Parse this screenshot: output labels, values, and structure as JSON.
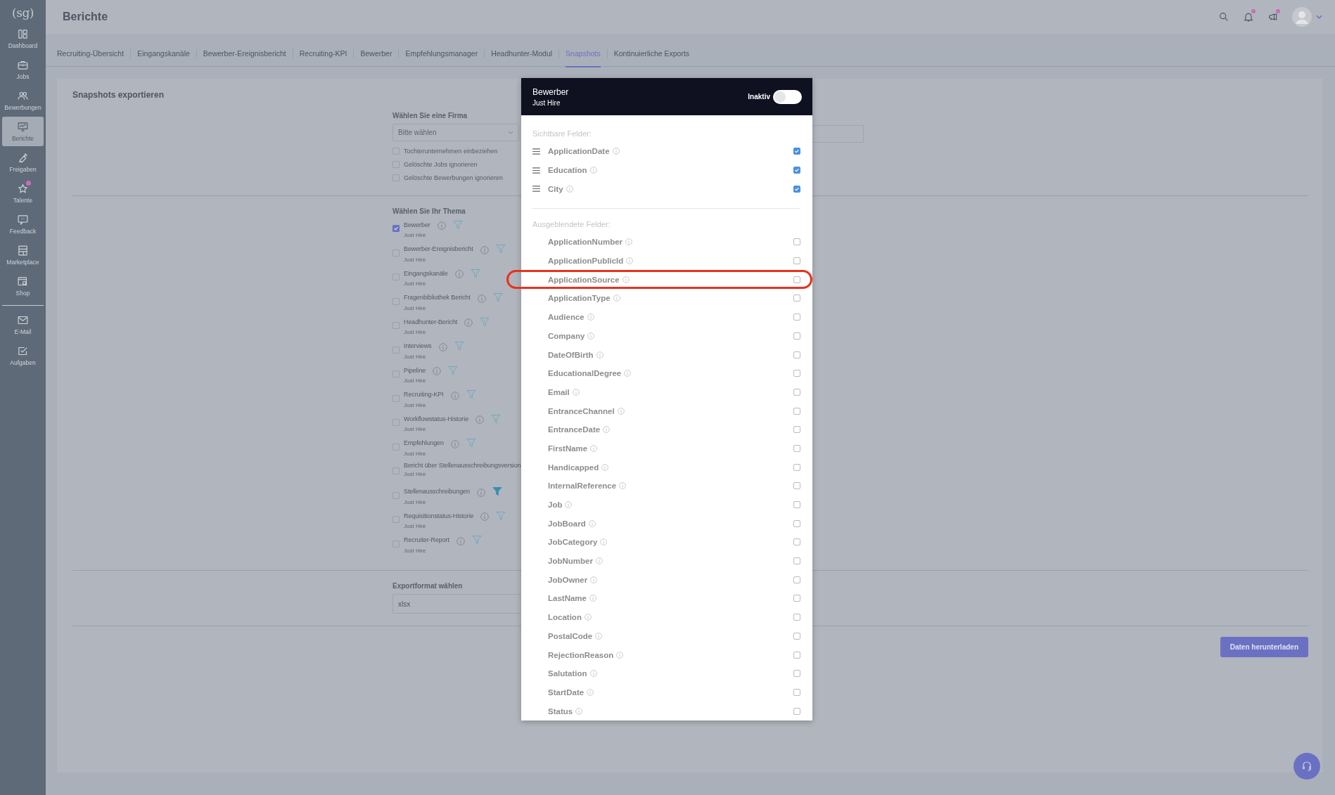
{
  "sidebar": {
    "logo": "(sg)",
    "items": [
      {
        "label": "Dashboard",
        "selected": false,
        "badge": false
      },
      {
        "label": "Jobs",
        "selected": false,
        "badge": false
      },
      {
        "label": "Bewerbungen",
        "selected": false,
        "badge": false
      },
      {
        "label": "Berichte",
        "selected": true,
        "badge": false
      },
      {
        "label": "Freigaben",
        "selected": false,
        "badge": false
      },
      {
        "label": "Talente",
        "selected": false,
        "badge": true
      },
      {
        "label": "Feedback",
        "selected": false,
        "badge": false
      },
      {
        "label": "Marketplace",
        "selected": false,
        "badge": false
      },
      {
        "label": "Shop",
        "selected": false,
        "badge": false
      }
    ],
    "bottom_items": [
      {
        "label": "E-Mail",
        "selected": false,
        "badge": false
      },
      {
        "label": "Aufgaben",
        "selected": false,
        "badge": false
      }
    ]
  },
  "header": {
    "title": "Berichte",
    "icons": [
      {
        "kind": "search",
        "badge": false
      },
      {
        "kind": "bell",
        "badge": true
      },
      {
        "kind": "megaphone",
        "badge": true
      },
      {
        "kind": "avatar"
      }
    ]
  },
  "tabs": [
    {
      "label": "Recruiting-Übersicht",
      "selected": false
    },
    {
      "label": "Eingangskanäle",
      "selected": false
    },
    {
      "label": "Bewerber-Ereignisbericht",
      "selected": false
    },
    {
      "label": "Recruiting-KPI",
      "selected": false
    },
    {
      "label": "Bewerber",
      "selected": false
    },
    {
      "label": "Empfehlungsmanager",
      "selected": false
    },
    {
      "label": "Headhunter-Modul",
      "selected": false
    },
    {
      "label": "Snapshots",
      "selected": true
    },
    {
      "label": "Kontinuierliche Exports",
      "selected": false
    }
  ],
  "card": {
    "title": "Snapshots exportieren",
    "company": {
      "label": "Wählen Sie eine Firma",
      "placeholder": "Bitte wählen",
      "options": [
        {
          "label": "Tochterunternehmen einbeziehen",
          "checked": false
        },
        {
          "label": "Gelöschte Jobs ignorieren",
          "checked": false
        },
        {
          "label": "Gelöschte Bewerbungen ignorieren",
          "checked": false
        }
      ]
    },
    "topic": {
      "label": "Wählen Sie Ihr Thema",
      "items": [
        {
          "name": "Bewerber",
          "sub": "Just Hire",
          "checked": true,
          "kind": "actions",
          "filter_active": false
        },
        {
          "name": "Bewerber-Ereignisbericht",
          "sub": "Just Hire",
          "checked": false,
          "kind": "actions",
          "filter_active": false
        },
        {
          "name": "Eingangskanäle",
          "sub": "Just Hire",
          "checked": false,
          "kind": "actions",
          "filter_active": false
        },
        {
          "name": "Fragenbibliothek Bericht",
          "sub": "Just Hire",
          "checked": false,
          "kind": "actions",
          "filter_active": false
        },
        {
          "name": "Headhunter-Bericht",
          "sub": "Just Hire",
          "checked": false,
          "kind": "actions",
          "filter_active": false
        },
        {
          "name": "Interviews",
          "sub": "Just Hire",
          "checked": false,
          "kind": "actions",
          "filter_active": false
        },
        {
          "name": "Pipeline",
          "sub": "Just Hire",
          "checked": false,
          "kind": "actions",
          "filter_active": false
        },
        {
          "name": "Recruiting-KPI",
          "sub": "Just Hire",
          "checked": false,
          "kind": "actions",
          "filter_active": false
        },
        {
          "name": "Workflowstatus-Historie",
          "sub": "Just Hire",
          "checked": false,
          "kind": "actions",
          "filter_active": false
        },
        {
          "name": "Empfehlungen",
          "sub": "Just Hire",
          "checked": false,
          "kind": "actions",
          "filter_active": false
        },
        {
          "name": "Bericht über Stellenausschreibungsversion",
          "sub": "Just Hire",
          "checked": false,
          "kind": "plain"
        },
        {
          "name": "Stellenausschreibungen",
          "sub": "Just Hire",
          "checked": false,
          "kind": "actions",
          "filter_active": true
        },
        {
          "name": "Requisitionstatus-Historie",
          "sub": "Just Hire",
          "checked": false,
          "kind": "actions",
          "filter_active": false
        },
        {
          "name": "Recruiter-Report",
          "sub": "Just Hire",
          "checked": false,
          "kind": "actions",
          "filter_active": false
        }
      ]
    },
    "format": {
      "label": "Exportformat wählen",
      "value": "xlsx"
    },
    "download_button": "Daten herunterladen"
  },
  "modal": {
    "title": "Bewerber",
    "subtitle": "Just Hire",
    "toggle": {
      "label": "Inaktiv",
      "on": false
    },
    "visible_label": "Sichtbare Felder:",
    "visible_fields": [
      {
        "name": "ApplicationDate",
        "checked": true
      },
      {
        "name": "Education",
        "checked": true
      },
      {
        "name": "City",
        "checked": true
      }
    ],
    "hidden_label": "Ausgeblendete Felder:",
    "hidden_fields": [
      {
        "name": "ApplicationNumber",
        "checked": false,
        "highlighted": false
      },
      {
        "name": "ApplicationPublicId",
        "checked": false,
        "highlighted": false
      },
      {
        "name": "ApplicationSource",
        "checked": false,
        "highlighted": true
      },
      {
        "name": "ApplicationType",
        "checked": false,
        "highlighted": false
      },
      {
        "name": "Audience",
        "checked": false,
        "highlighted": false
      },
      {
        "name": "Company",
        "checked": false,
        "highlighted": false
      },
      {
        "name": "DateOfBirth",
        "checked": false,
        "highlighted": false
      },
      {
        "name": "EducationalDegree",
        "checked": false,
        "highlighted": false
      },
      {
        "name": "Email",
        "checked": false,
        "highlighted": false
      },
      {
        "name": "EntranceChannel",
        "checked": false,
        "highlighted": false
      },
      {
        "name": "EntranceDate",
        "checked": false,
        "highlighted": false
      },
      {
        "name": "FirstName",
        "checked": false,
        "highlighted": false
      },
      {
        "name": "Handicapped",
        "checked": false,
        "highlighted": false
      },
      {
        "name": "InternalReference",
        "checked": false,
        "highlighted": false
      },
      {
        "name": "Job",
        "checked": false,
        "highlighted": false
      },
      {
        "name": "JobBoard",
        "checked": false,
        "highlighted": false
      },
      {
        "name": "JobCategory",
        "checked": false,
        "highlighted": false
      },
      {
        "name": "JobNumber",
        "checked": false,
        "highlighted": false
      },
      {
        "name": "JobOwner",
        "checked": false,
        "highlighted": false
      },
      {
        "name": "LastName",
        "checked": false,
        "highlighted": false
      },
      {
        "name": "Location",
        "checked": false,
        "highlighted": false
      },
      {
        "name": "PostalCode",
        "checked": false,
        "highlighted": false
      },
      {
        "name": "RejectionReason",
        "checked": false,
        "highlighted": false
      },
      {
        "name": "Salutation",
        "checked": false,
        "highlighted": false
      },
      {
        "name": "StartDate",
        "checked": false,
        "highlighted": false
      },
      {
        "name": "Status",
        "checked": false,
        "highlighted": false
      }
    ]
  }
}
